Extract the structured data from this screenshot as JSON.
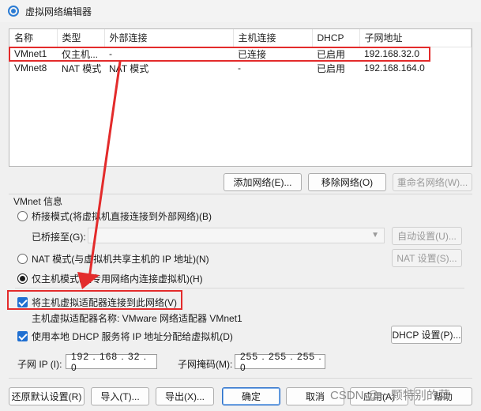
{
  "window": {
    "title": "虚拟网络编辑器",
    "icon": "network-globe-icon"
  },
  "table": {
    "headers": [
      "名称",
      "类型",
      "外部连接",
      "主机连接",
      "DHCP",
      "子网地址"
    ],
    "rows": [
      [
        "VMnet1",
        "仅主机...",
        "-",
        "已连接",
        "已启用",
        "192.168.32.0"
      ],
      [
        "VMnet8",
        "NAT 模式",
        "NAT 模式",
        "-",
        "已启用",
        "192.168.164.0"
      ]
    ]
  },
  "table_buttons": {
    "add": "添加网络(E)...",
    "remove": "移除网络(O)",
    "rename": "重命名网络(W)..."
  },
  "vmnet_info": {
    "group_label": "VMnet 信息",
    "bridge_radio": "桥接模式(将虚拟机直接连接到外部网络)(B)",
    "bridged_to_label": "已桥接至(G):",
    "bridged_to_value": "",
    "auto_settings": "自动设置(U)...",
    "nat_radio": "NAT 模式(与虚拟机共享主机的 IP 地址)(N)",
    "nat_settings": "NAT 设置(S)...",
    "host_only_radio": "仅主机模式(在专用网络内连接虚拟机)(H)",
    "selected_mode": "host_only",
    "connect_adapter_check": "将主机虚拟适配器连接到此网络(V)",
    "adapter_name_label": "主机虚拟适配器名称: VMware 网络适配器 VMnet1",
    "dhcp_check": "使用本地 DHCP 服务将 IP 地址分配给虚拟机(D)",
    "dhcp_settings": "DHCP 设置(P)...",
    "subnet_ip_label": "子网 IP (I):",
    "subnet_ip_value": "192 . 168 . 32 . 0",
    "subnet_mask_label": "子网掩码(M):",
    "subnet_mask_value": "255 . 255 . 255 . 0"
  },
  "footer": {
    "restore": "还原默认设置(R)",
    "import": "导入(T)...",
    "export": "导出(X)...",
    "ok": "确定",
    "cancel": "取消",
    "apply": "应用(A)",
    "help": "帮助"
  },
  "watermark": "CSDN @一颗特别的菜",
  "annotation_color": "#e32b2b"
}
